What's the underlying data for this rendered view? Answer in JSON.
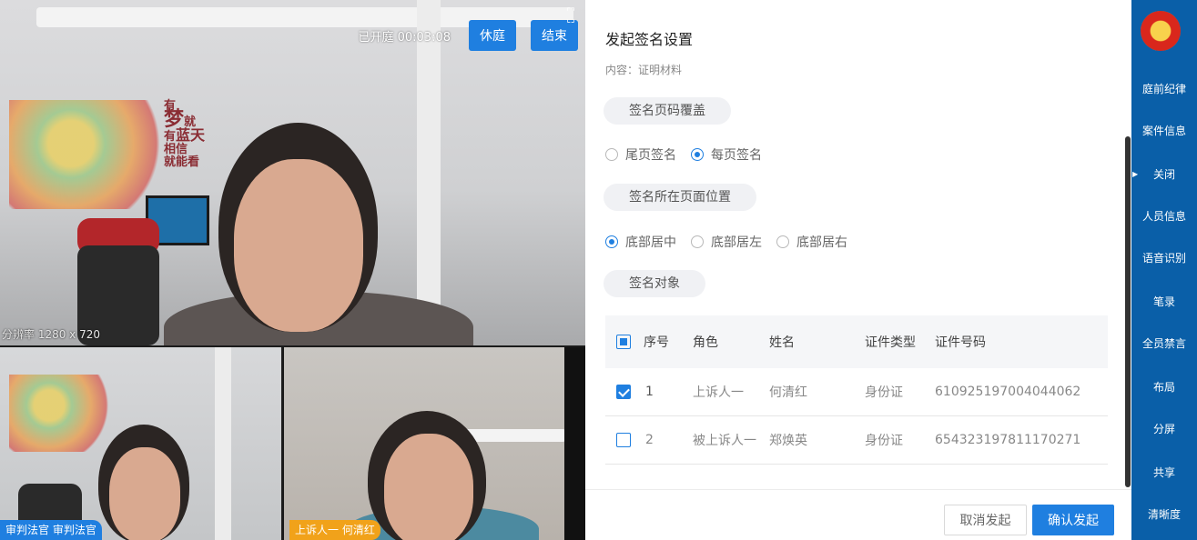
{
  "video": {
    "timer": "已开庭 00:03:08",
    "recess_label": "休庭",
    "end_label": "结束",
    "resolution": "分辨率 1280 x 720",
    "wall_text": [
      "有",
      "梦",
      "就",
      "有",
      "蓝",
      "天",
      "相",
      "信",
      "就",
      "能",
      "看"
    ],
    "participants": [
      {
        "tag": "审判法官 审判法官",
        "tag_color": "#1f7fe0"
      },
      {
        "tag": "上诉人一 何清红",
        "tag_color": "#f1a21a"
      }
    ]
  },
  "dialog": {
    "title": "发起签名设置",
    "content": "内容：证明材料",
    "sections": {
      "page_cover": "签名页码覆盖",
      "page_position": "签名所在页面位置",
      "target": "签名对象"
    },
    "page_cover_options": [
      {
        "label": "尾页签名",
        "selected": false
      },
      {
        "label": "每页签名",
        "selected": true
      }
    ],
    "position_options": [
      {
        "label": "底部居中",
        "selected": true
      },
      {
        "label": "底部居左",
        "selected": false
      },
      {
        "label": "底部居右",
        "selected": false
      }
    ],
    "table": {
      "headers": [
        "序号",
        "角色",
        "姓名",
        "证件类型",
        "证件号码"
      ],
      "rows": [
        {
          "index": "1",
          "role": "上诉人一",
          "name": "何清红",
          "id_type": "身份证",
          "id_no": "610925197004044062",
          "checked": true
        },
        {
          "index": "2",
          "role": "被上诉人一",
          "name": "郑焕英",
          "id_type": "身份证",
          "id_no": "654323197811170271",
          "checked": false
        }
      ]
    },
    "cancel_label": "取消发起",
    "confirm_label": "确认发起"
  },
  "sidenav": {
    "items": [
      {
        "label": "庭前纪律"
      },
      {
        "label": "案件信息"
      },
      {
        "label": "关闭"
      },
      {
        "label": "人员信息"
      },
      {
        "label": "语音识别"
      },
      {
        "label": "笔录"
      },
      {
        "label": "全员禁言"
      },
      {
        "label": "布局"
      },
      {
        "label": "分屏"
      },
      {
        "label": "共享"
      },
      {
        "label": "清晰度"
      }
    ]
  },
  "colors": {
    "accent": "#1f7fe0",
    "nav": "#0a5fa8",
    "tag_orange": "#f1a21a"
  }
}
